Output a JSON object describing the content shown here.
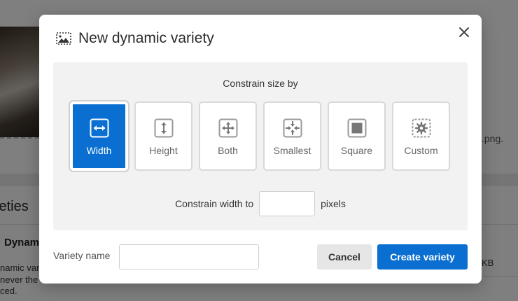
{
  "background": {
    "file_ext": ".png.",
    "section_heading": "ieties",
    "row_title": "Dynam",
    "row_desc_1": "namic variet",
    "row_desc_2": "never the u",
    "row_desc_3": "ced.",
    "row_size": "KB"
  },
  "modal": {
    "title": "New dynamic variety",
    "title_icon": "image-crop-icon",
    "close_icon": "close-icon",
    "constrain_title": "Constrain size by",
    "options": [
      {
        "label": "Width",
        "icon": "width-arrows-icon",
        "selected": true
      },
      {
        "label": "Height",
        "icon": "height-arrows-icon",
        "selected": false
      },
      {
        "label": "Both",
        "icon": "both-arrows-icon",
        "selected": false
      },
      {
        "label": "Smallest",
        "icon": "shrink-arrows-icon",
        "selected": false
      },
      {
        "label": "Square",
        "icon": "square-icon",
        "selected": false
      },
      {
        "label": "Custom",
        "icon": "gear-icon",
        "selected": false
      }
    ],
    "constrain_width_label": "Constrain width to",
    "constrain_width_value": "",
    "pixels_label": "pixels",
    "variety_name_label": "Variety name",
    "variety_name_value": "",
    "cancel_label": "Cancel",
    "create_label": "Create variety"
  },
  "colors": {
    "accent": "#0a6fd0",
    "panel_bg": "#f2f2f2",
    "cancel_bg": "#e6e6e6"
  }
}
